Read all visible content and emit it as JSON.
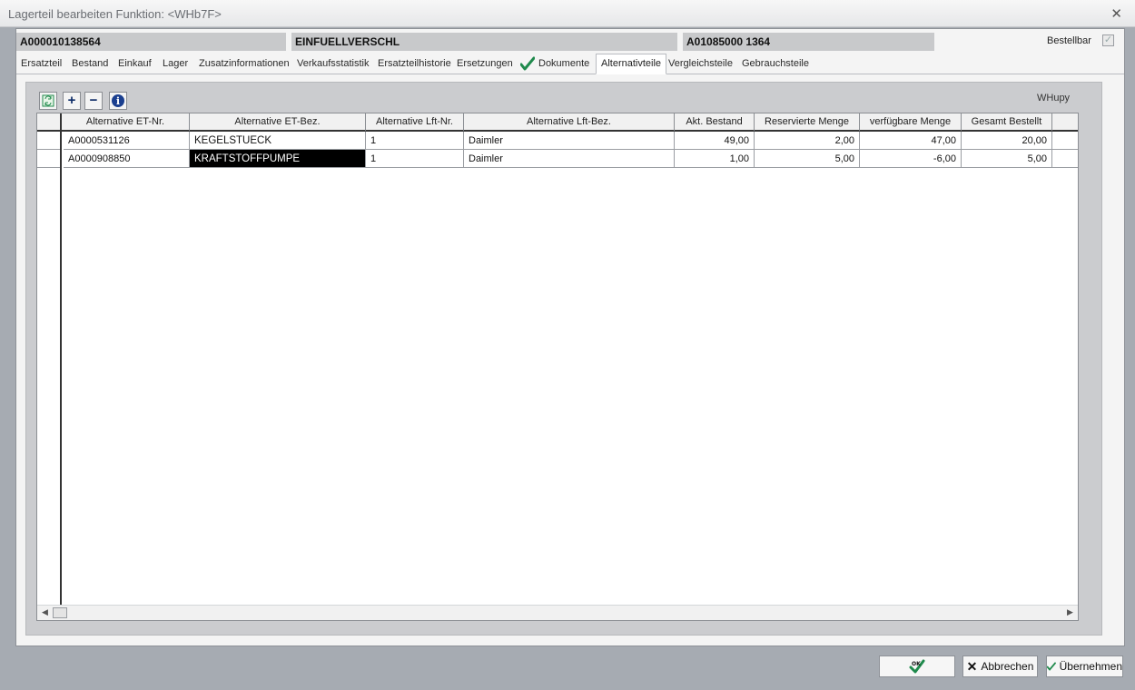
{
  "window": {
    "title": "Lagerteil bearbeiten   Funktion: <WHb7F>"
  },
  "header": {
    "part_number": "A000010138564",
    "description": "EINFUELLVERSCHL",
    "location": "A01085000  1364",
    "bestellbar_label": "Bestellbar",
    "bestellbar_checked": true
  },
  "tabs": [
    "Ersatzteil",
    "Bestand",
    "Einkauf",
    "Lager",
    "Zusatzinformationen",
    "Verkaufsstatistik",
    "Ersatzteilhistorie",
    "Ersetzungen",
    "Dokumente",
    "Alternativteile",
    "Vergleichsteile",
    "Gebrauchsteile"
  ],
  "active_tab": "Alternativteile",
  "panel": {
    "code": "WHupy"
  },
  "table": {
    "columns": [
      "Alternative ET-Nr.",
      "Alternative ET-Bez.",
      "Alternative Lft-Nr.",
      "Alternative Lft-Bez.",
      "Akt. Bestand",
      "Reservierte Menge",
      "verfügbare Menge",
      "Gesamt Bestellt"
    ],
    "rows": [
      [
        "A0000531126",
        "KEGELSTUECK",
        "1",
        "Daimler",
        "49,00",
        "2,00",
        "47,00",
        "20,00"
      ],
      [
        "A0000908850",
        "KRAFTSTOFFPUMPE",
        "1",
        "Daimler",
        "1,00",
        "5,00",
        "-6,00",
        "5,00"
      ]
    ]
  },
  "buttons": {
    "ok": "OK",
    "cancel": "Abbrechen",
    "apply": "Übernehmen"
  },
  "colors": {
    "selection": "#000000",
    "check_green": "#1f8a4c",
    "info_blue": "#1b3f8f"
  }
}
